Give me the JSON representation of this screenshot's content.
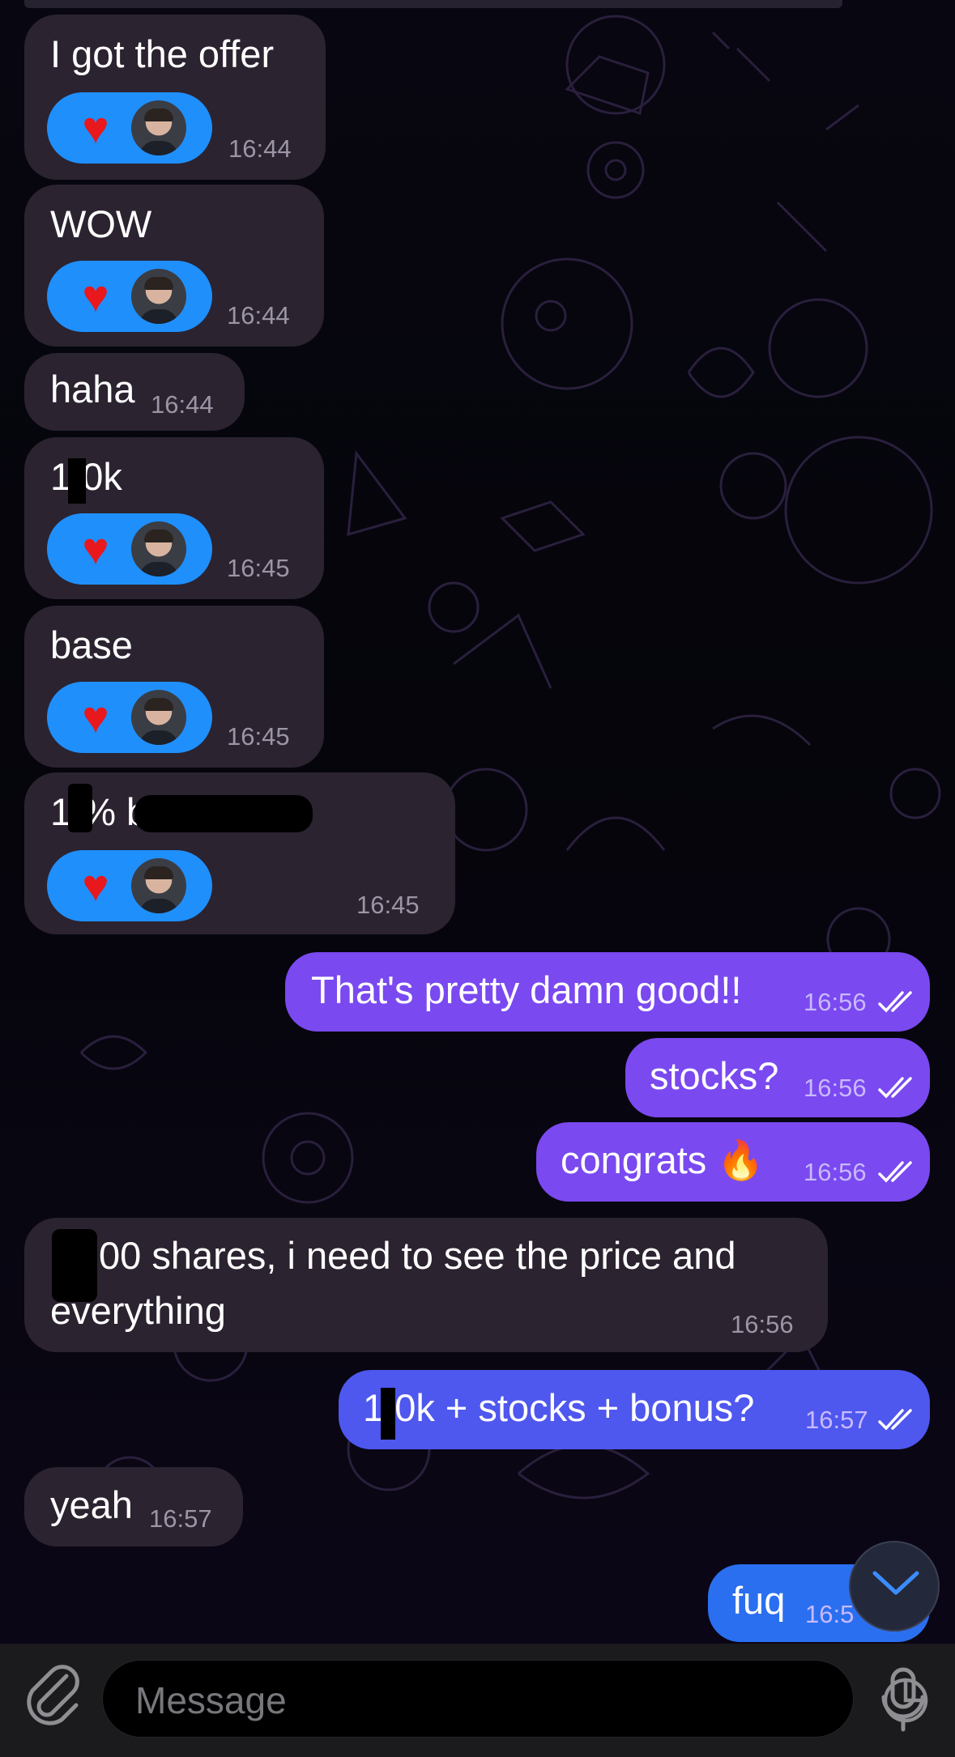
{
  "composer": {
    "placeholder": "Message",
    "attach_icon": "paperclip-icon",
    "sticker_icon": "sticker-icon",
    "mic_icon": "microphone-icon"
  },
  "colors": {
    "incoming_bubble": "#2b2330",
    "outgoing_bubble": "#7a49f0",
    "reaction_pill": "#1f8ffb",
    "heart": "#e8181c"
  },
  "messages": [
    {
      "direction": "in",
      "text": "I got the offer",
      "time": "16:44",
      "reaction": "heart-icon"
    },
    {
      "direction": "in",
      "text": "WOW",
      "time": "16:44",
      "reaction": "heart-icon"
    },
    {
      "direction": "in",
      "text": "haha",
      "time": "16:44"
    },
    {
      "direction": "in",
      "text": "1 0k",
      "time": "16:45",
      "reaction": "heart-icon"
    },
    {
      "direction": "in",
      "text": "base",
      "time": "16:45",
      "reaction": "heart-icon"
    },
    {
      "direction": "in",
      "text": "1 %  bonus",
      "time": "16:45",
      "reaction": "heart-icon"
    },
    {
      "direction": "out",
      "text": "That's pretty damn good!!",
      "time": "16:56",
      "status": "read"
    },
    {
      "direction": "out",
      "text": "stocks?",
      "time": "16:56",
      "status": "read"
    },
    {
      "direction": "out",
      "text": "congrats 🔥",
      "time": "16:56",
      "status": "read"
    },
    {
      "direction": "in",
      "text": "00 shares, i need to see the price and",
      "text2": "everything",
      "time": "16:56"
    },
    {
      "direction": "out",
      "text": "1 0k + stocks + bonus?",
      "time": "16:57",
      "status": "read"
    },
    {
      "direction": "in",
      "text": "yeah",
      "time": "16:57"
    },
    {
      "direction": "out",
      "text": "fuq",
      "time": "16:5",
      "status": "read"
    }
  ]
}
